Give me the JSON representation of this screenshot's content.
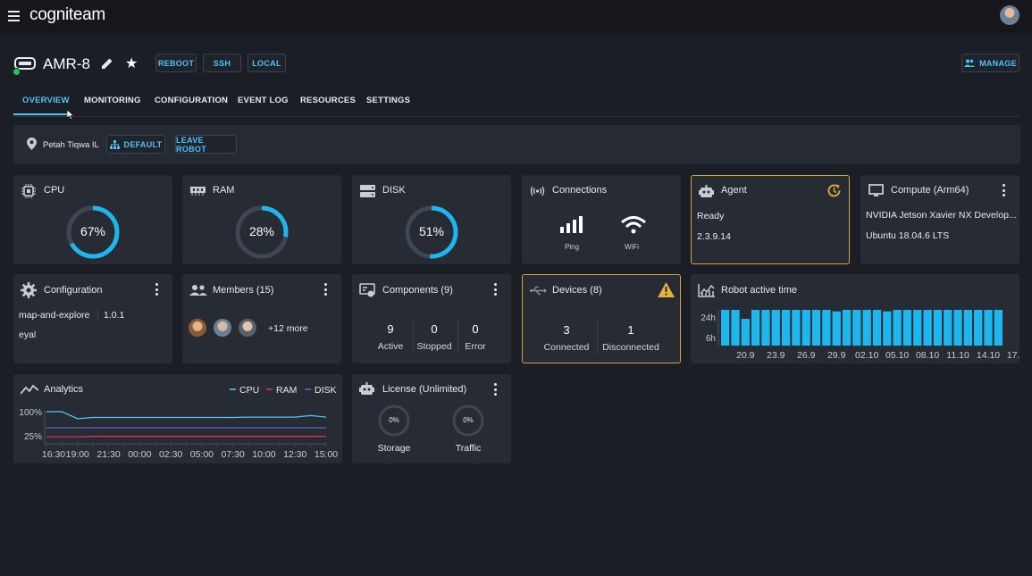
{
  "app": {
    "logo": "cogniteam"
  },
  "robot": {
    "name": "AMR-8",
    "actions": {
      "reboot": "REBOOT",
      "ssh": "SSH",
      "local": "LOCAL"
    },
    "manage": "MANAGE"
  },
  "tabs": [
    "OVERVIEW",
    "MONITORING",
    "CONFIGURATION",
    "EVENT LOG",
    "RESOURCES",
    "SETTINGS"
  ],
  "location": {
    "place": "Petah Tiqwa IL",
    "map_button": "DEFAULT",
    "leave_button": "LEAVE ROBOT"
  },
  "cpu": {
    "title": "CPU",
    "value": "67%",
    "percent": 67
  },
  "ram": {
    "title": "RAM",
    "value": "28%",
    "percent": 28
  },
  "disk": {
    "title": "DISK",
    "value": "51%",
    "percent": 51
  },
  "connections": {
    "title": "Connections",
    "ping": "Ping",
    "wifi": "WiFi"
  },
  "agent": {
    "title": "Agent",
    "status": "Ready",
    "version": "2.3.9.14"
  },
  "compute": {
    "title": "Compute (Arm64)",
    "device": "NVIDIA Jetson Xavier NX Develop...",
    "os": "Ubuntu 18.04.6 LTS"
  },
  "configuration": {
    "title": "Configuration",
    "name": "map-and-explore",
    "version": "1.0.1",
    "owner": "eyal"
  },
  "members": {
    "title": "Members (15)",
    "more": "+12 more"
  },
  "components": {
    "title": "Components (9)",
    "active_count": "9",
    "active": "Active",
    "stopped_count": "0",
    "stopped": "Stopped",
    "error_count": "0",
    "error": "Error"
  },
  "devices": {
    "title": "Devices (8)",
    "connected_count": "3",
    "connected": "Connected",
    "disconnected_count": "1",
    "disconnected": "Disconnected"
  },
  "active_time": {
    "title": "Robot active time",
    "y_ticks": [
      "24h",
      "6h"
    ],
    "x_ticks": [
      "20.9",
      "23.9",
      "26.9",
      "29.9",
      "02.10",
      "05.10",
      "08.10",
      "11.10",
      "14.10",
      "17.10"
    ]
  },
  "analytics": {
    "title": "Analytics",
    "legend": [
      "CPU",
      "RAM",
      "DISK"
    ],
    "y_ticks": [
      "100%",
      "25%"
    ],
    "x_ticks": [
      "16:30",
      "19:00",
      "21:30",
      "00:00",
      "02:30",
      "05:00",
      "07:30",
      "10:00",
      "12:30",
      "15:00"
    ]
  },
  "license": {
    "title": "License (Unlimited)",
    "storage_value": "0%",
    "storage": "Storage",
    "traffic_value": "0%",
    "traffic": "Traffic"
  },
  "colors": {
    "accent": "#4fc3f7",
    "warning": "#d8a43a",
    "ram_line": "#d6335f",
    "disk_line": "#5c6bc0",
    "online": "#25c25a"
  },
  "chart_data": [
    {
      "type": "bar",
      "title": "Robot active time",
      "categories": [
        "20.9",
        "21.9",
        "22.9",
        "23.9",
        "24.9",
        "25.9",
        "26.9",
        "27.9",
        "28.9",
        "29.9",
        "30.9",
        "01.10",
        "02.10",
        "03.10",
        "04.10",
        "05.10",
        "06.10",
        "07.10",
        "08.10",
        "09.10",
        "10.10",
        "11.10",
        "12.10",
        "13.10",
        "14.10",
        "15.10",
        "16.10",
        "17.10"
      ],
      "values": [
        24,
        24,
        18,
        24,
        24,
        24,
        24,
        24,
        24,
        24,
        24,
        23,
        24,
        24,
        24,
        24,
        23,
        24,
        24,
        24,
        24,
        24,
        24,
        24,
        24,
        24,
        24,
        24
      ],
      "unit": "h"
    },
    {
      "type": "line",
      "title": "Analytics",
      "x": [
        "16:30",
        "17:45",
        "19:00",
        "20:15",
        "21:30",
        "22:45",
        "00:00",
        "01:15",
        "02:30",
        "03:45",
        "05:00",
        "06:15",
        "07:30",
        "08:45",
        "10:00",
        "11:15",
        "12:30",
        "13:45",
        "15:00"
      ],
      "series": [
        {
          "name": "CPU",
          "values": [
            100,
            100,
            78,
            82,
            82,
            82,
            82,
            82,
            82,
            82,
            82,
            82,
            82,
            83,
            83,
            83,
            83,
            88,
            83
          ]
        },
        {
          "name": "RAM",
          "values": [
            22,
            22,
            22,
            23,
            23,
            23,
            23,
            23,
            23,
            23,
            23,
            23,
            23,
            23,
            23,
            23,
            23,
            23,
            23
          ]
        },
        {
          "name": "DISK",
          "values": [
            50,
            50,
            50,
            50,
            50,
            50,
            50,
            50,
            50,
            50,
            50,
            50,
            50,
            50,
            50,
            50,
            50,
            50,
            50
          ]
        }
      ],
      "ylim": [
        0,
        100
      ]
    }
  ]
}
